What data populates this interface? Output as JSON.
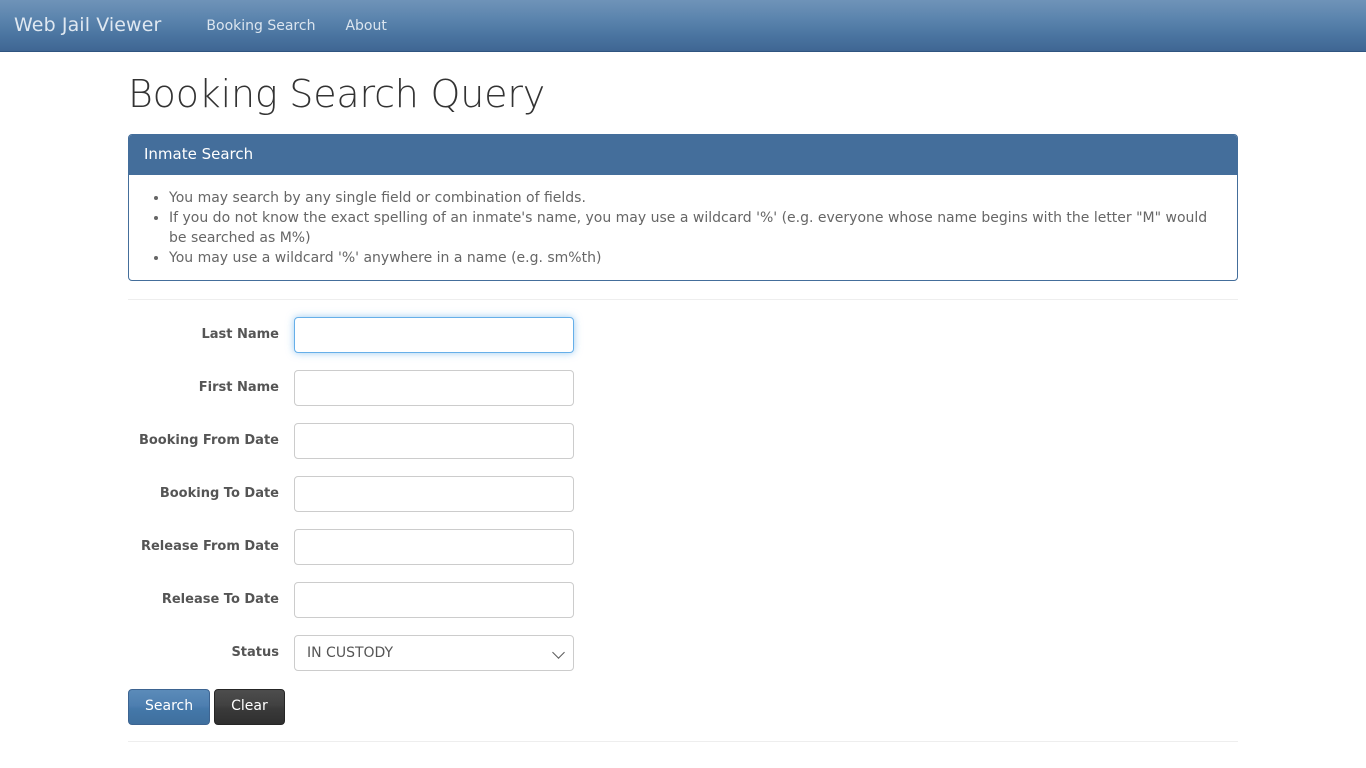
{
  "navbar": {
    "brand": "Web Jail Viewer",
    "links": [
      {
        "label": "Booking Search"
      },
      {
        "label": "About"
      }
    ]
  },
  "page": {
    "title": "Booking Search Query"
  },
  "panel": {
    "heading": "Inmate Search",
    "hints": [
      "You may search by any single field or combination of fields.",
      "If you do not know the exact spelling of an inmate's name, you may use a wildcard '%' (e.g. everyone whose name begins with the letter \"M\" would be searched as M%)",
      "You may use a wildcard '%' anywhere in a name (e.g. sm%th)"
    ]
  },
  "form": {
    "fields": [
      {
        "label": "Last Name",
        "value": "",
        "placeholder": ""
      },
      {
        "label": "First Name",
        "value": "",
        "placeholder": ""
      },
      {
        "label": "Booking From Date",
        "value": "",
        "placeholder": ""
      },
      {
        "label": "Booking To Date",
        "value": "",
        "placeholder": ""
      },
      {
        "label": "Release From Date",
        "value": "",
        "placeholder": ""
      },
      {
        "label": "Release To Date",
        "value": "",
        "placeholder": ""
      }
    ],
    "status": {
      "label": "Status",
      "selected": "IN CUSTODY",
      "options": [
        "IN CUSTODY"
      ],
      "icon": "chevron-down-icon"
    },
    "buttons": {
      "search": "Search",
      "clear": "Clear"
    }
  },
  "colors": {
    "navbar_top": "#6f93b8",
    "navbar_bottom": "#3f6693",
    "panel_accent": "#446e9b",
    "focus_ring": "#66afe9",
    "primary_button": "#4478a9",
    "default_button": "#3a3a3a"
  }
}
